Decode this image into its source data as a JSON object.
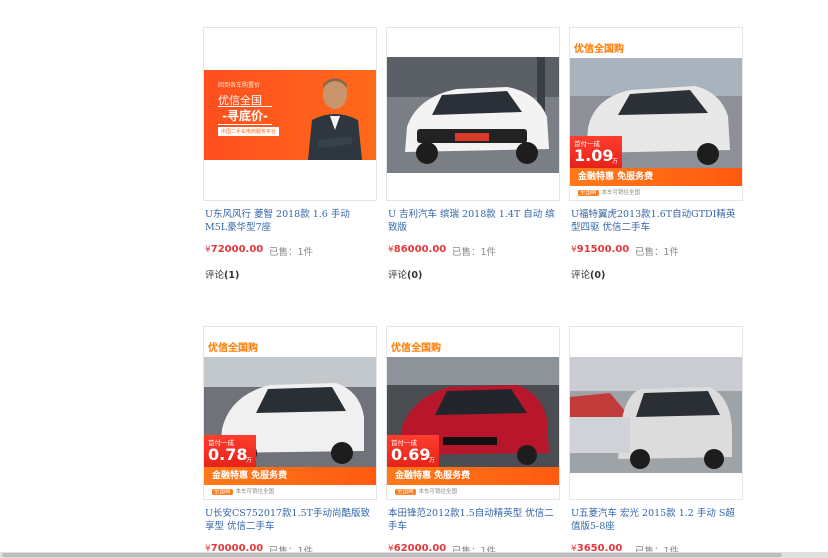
{
  "currency_symbol": "¥",
  "sold_label": "已售：",
  "comment_label": "评论",
  "products": [
    {
      "title": "U东风风行 菱智 2018款 1.6 手动 M5L豪华型7座",
      "price": "72000.00",
      "sold": "1件",
      "comments": "(1)",
      "image": {
        "kind": "banner",
        "line1": "回到各车购置价",
        "line2": "优信全国",
        "line3": "-寻底价-",
        "line4": "中国二手车电商服务平台"
      }
    },
    {
      "title": "U 吉利汽车 缤瑞 2018款 1.4T 自动 缤致版",
      "price": "86000.00",
      "sold": "1件",
      "comments": "(0)",
      "image": {
        "kind": "photo",
        "car_color": "#f3f3f3"
      }
    },
    {
      "title": "U福特翼虎2013款1.6T自动GTDI精英型四驱 优信二手车",
      "price": "91500.00",
      "sold": "1件",
      "comments": "(0)",
      "image": {
        "kind": "promo",
        "top_label": "优信全国购",
        "badge_l1": "首付一成",
        "badge_value": "1.09",
        "badge_unit": "万",
        "promo": "金融特惠 免服务费",
        "promo_tag": "全国购",
        "promo_sub": "本车可销往全国",
        "car_color": "#e8e8e8"
      }
    },
    {
      "title": "U长安CS752017款1.5T手动尚酷版致享型 优信二手车",
      "price": "70000.00",
      "sold": "1件",
      "comments": "",
      "image": {
        "kind": "promo",
        "top_label": "优信全国购",
        "badge_l1": "首付一成",
        "badge_value": "0.78",
        "badge_unit": "万",
        "promo": "金融特惠 免服务费",
        "promo_tag": "全国购",
        "promo_sub": "本车可销往全国",
        "car_color": "#f0f0f0"
      }
    },
    {
      "title": "本田锋范2012款1.5自动精英型 优信二手车",
      "price": "62000.00",
      "sold": "1件",
      "comments": "",
      "image": {
        "kind": "promo",
        "top_label": "优信全国购",
        "badge_l1": "首付一成",
        "badge_value": "0.69",
        "badge_unit": "万",
        "promo": "金融特惠 免服务费",
        "promo_tag": "全国购",
        "promo_sub": "本车可销往全国",
        "car_color": "#b8162a"
      }
    },
    {
      "title": "U五菱汽车 宏光 2015款 1.2 手动 S超值版5-8座",
      "price": "3650.00",
      "sold": "1件",
      "comments": "",
      "image": {
        "kind": "photo",
        "car_color": "#dcdcdc"
      }
    }
  ]
}
